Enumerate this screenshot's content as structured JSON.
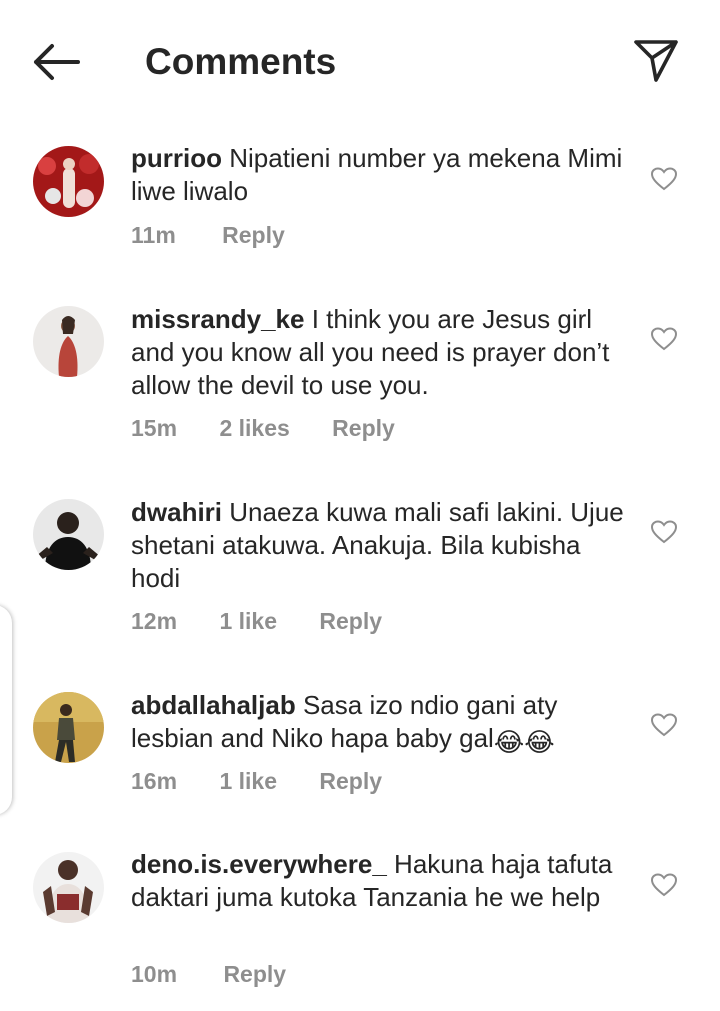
{
  "header": {
    "title": "Comments",
    "back_icon": "arrow-left-icon",
    "share_icon": "paper-plane-icon"
  },
  "comments": [
    {
      "username": "purrioo",
      "text": "Nipatieni number ya mekena Mimi liwe liwalo",
      "time": "11m",
      "likes": "",
      "reply": "Reply"
    },
    {
      "username": "missrandy_ke",
      "text": "I think you are Jesus girl and you know all you need is prayer don’t allow the devil to use you.",
      "time": "15m",
      "likes": "2 likes",
      "reply": "Reply"
    },
    {
      "username": "dwahiri",
      "text": "Unaeza kuwa mali safi lakini. Ujue shetani atakuwa. Anakuja. Bila kubisha hodi",
      "time": "12m",
      "likes": "1 like",
      "reply": "Reply"
    },
    {
      "username": "abdallahaljab",
      "text": "Sasa izo ndio gani aty lesbian and Niko hapa baby gal",
      "emoji": "😂😂",
      "time": "16m",
      "likes": "1 like",
      "reply": "Reply"
    },
    {
      "username": "deno.is.everywhere_",
      "text": "Hakuna haja tafuta daktari juma kutoka Tanzania he we help",
      "time": "10m",
      "likes": "",
      "reply": "Reply"
    }
  ]
}
